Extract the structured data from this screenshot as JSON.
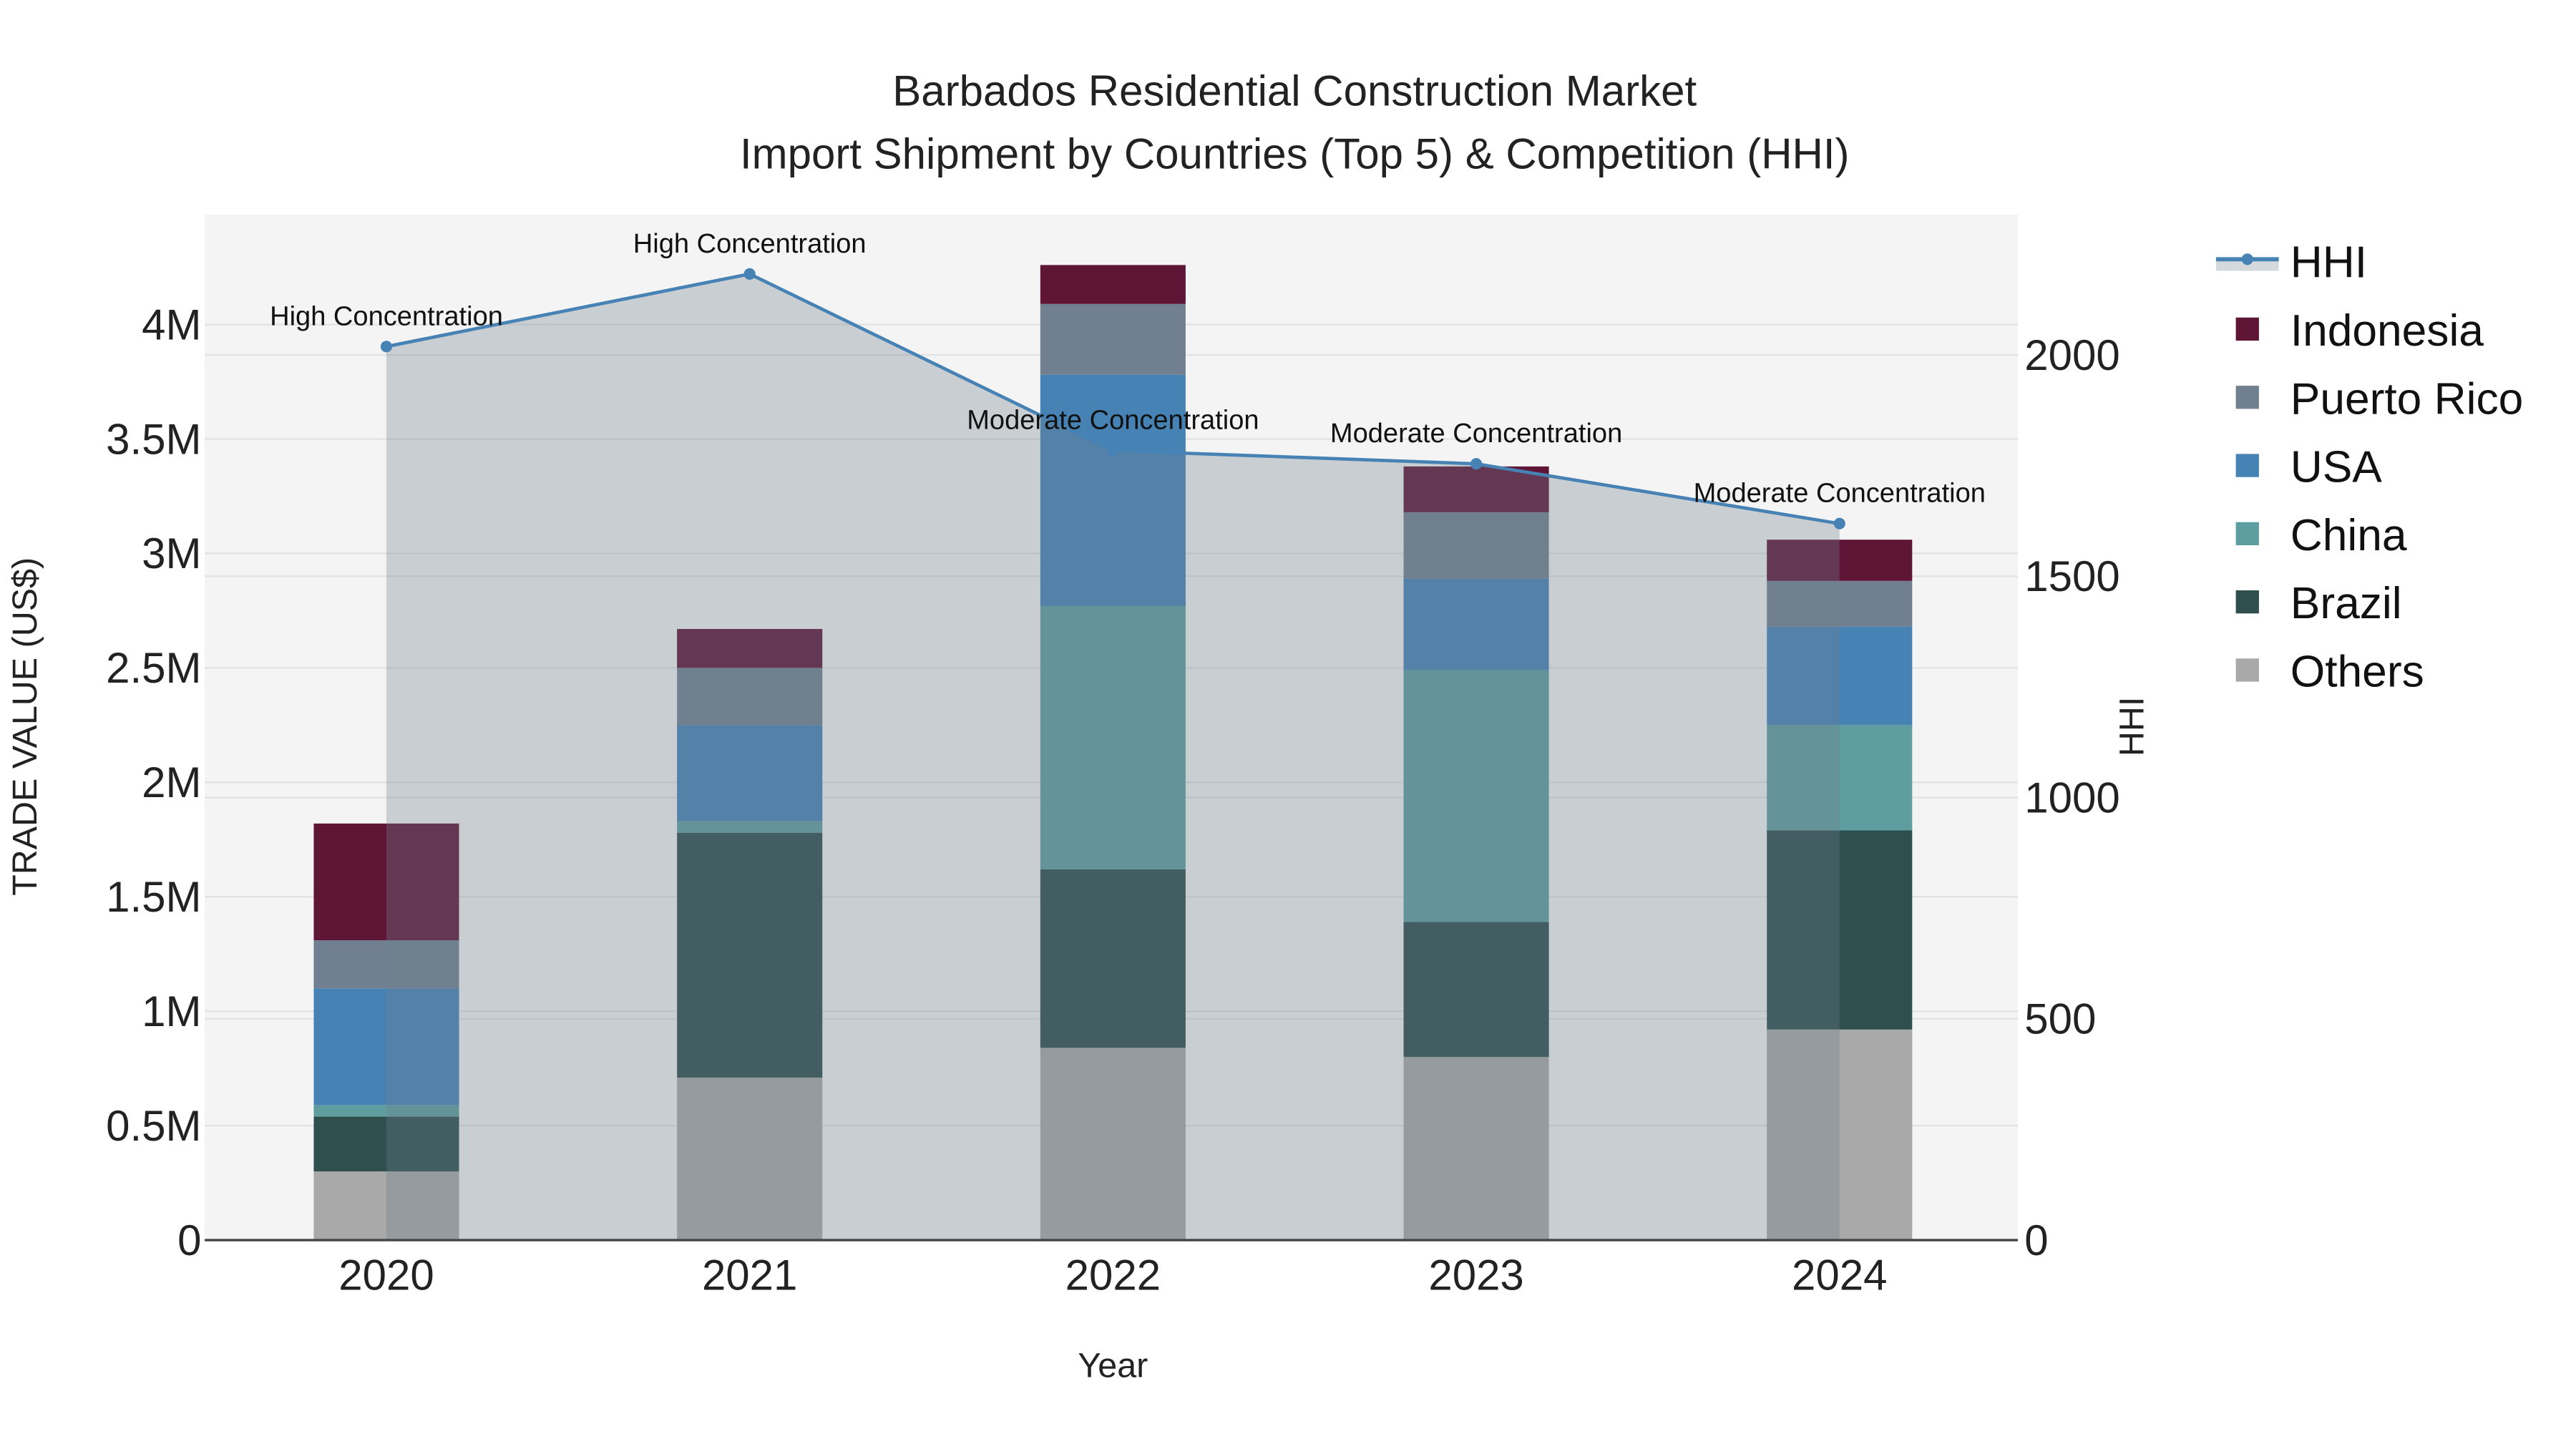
{
  "chart_data": {
    "type": "bar",
    "stacked": true,
    "title_line1": "Barbados Residential Construction Market",
    "title_line2": "Import Shipment by Countries (Top 5) & Competition (HHI)",
    "xlabel": "Year",
    "ylabel": "TRADE VALUE (US$)",
    "y2label": "HHI",
    "categories": [
      "2020",
      "2021",
      "2022",
      "2023",
      "2024"
    ],
    "ylim": [
      0,
      4480000
    ],
    "y2lim": [
      0,
      2317
    ],
    "yticks": [
      0,
      500000,
      1000000,
      1500000,
      2000000,
      2500000,
      3000000,
      3500000,
      4000000
    ],
    "ytick_labels": [
      "0",
      "0.5M",
      "1M",
      "1.5M",
      "2M",
      "2.5M",
      "3M",
      "3.5M",
      "4M"
    ],
    "y2ticks": [
      0,
      500,
      1000,
      1500,
      2000
    ],
    "y2tick_labels": [
      "0",
      "500",
      "1000",
      "1500",
      "2000"
    ],
    "grid": true,
    "legend_position": "right",
    "series": [
      {
        "name": "Others",
        "color": "#a9a9a9",
        "values": [
          300000,
          710000,
          840000,
          800000,
          920000
        ]
      },
      {
        "name": "Brazil",
        "color": "#2f4f4f",
        "values": [
          240000,
          1070000,
          780000,
          590000,
          870000
        ]
      },
      {
        "name": "China",
        "color": "#5f9ea0",
        "values": [
          50000,
          50000,
          1150000,
          1100000,
          460000
        ]
      },
      {
        "name": "USA",
        "color": "#4682b4",
        "values": [
          510000,
          420000,
          1010000,
          400000,
          430000
        ]
      },
      {
        "name": "Puerto Rico",
        "color": "#708090",
        "values": [
          210000,
          250000,
          310000,
          290000,
          200000
        ]
      },
      {
        "name": "Indonesia",
        "color": "#5f1535",
        "values": [
          510000,
          170000,
          170000,
          200000,
          180000
        ]
      }
    ],
    "hhi": {
      "name": "HHI",
      "color": "#4682b4",
      "values": [
        2019,
        2183,
        1784,
        1754,
        1619
      ],
      "annotations": [
        "High Concentration",
        "High Concentration",
        "Moderate Concentration",
        "Moderate Concentration",
        "Moderate Concentration"
      ]
    },
    "legend_order": [
      "HHI",
      "Indonesia",
      "Puerto Rico",
      "USA",
      "China",
      "Brazil",
      "Others"
    ]
  }
}
